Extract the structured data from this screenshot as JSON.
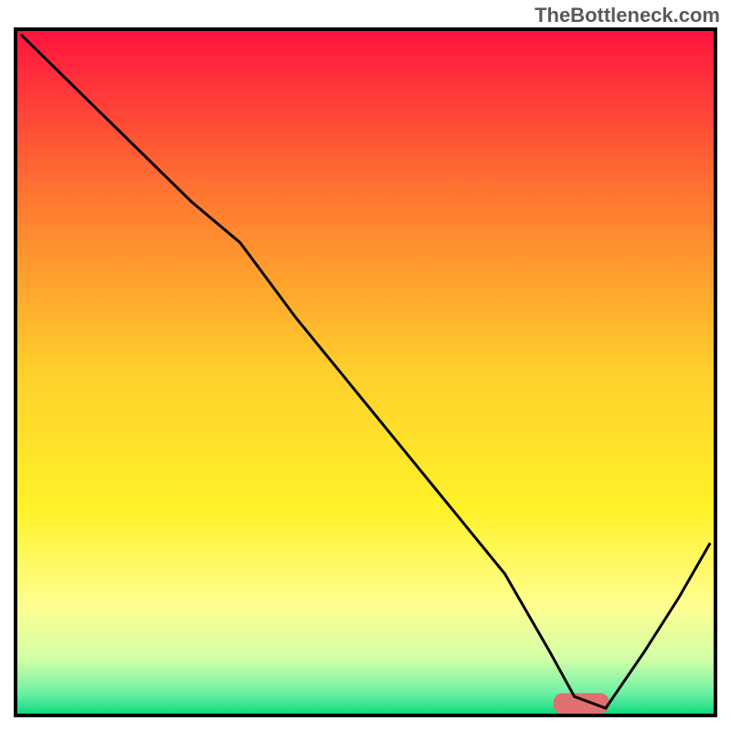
{
  "watermark": "TheBottleneck.com",
  "chart_data": {
    "type": "line",
    "title": "",
    "xlabel": "",
    "ylabel": "",
    "xlim": [
      0,
      100
    ],
    "ylim": [
      0,
      100
    ],
    "background_gradient": {
      "stops": [
        {
          "offset": 0.0,
          "color": "#ff143e"
        },
        {
          "offset": 0.25,
          "color": "#ff7a30"
        },
        {
          "offset": 0.5,
          "color": "#ffd02c"
        },
        {
          "offset": 0.7,
          "color": "#fff229"
        },
        {
          "offset": 0.84,
          "color": "#fffe8f"
        },
        {
          "offset": 0.92,
          "color": "#d2ffa7"
        },
        {
          "offset": 0.97,
          "color": "#6cf0a3"
        },
        {
          "offset": 1.0,
          "color": "#11d980"
        }
      ]
    },
    "optimum_marker": {
      "x_start": 77,
      "x_end": 85,
      "y": 1.5,
      "color": "#e07070",
      "width": 7.5,
      "height": 3
    },
    "series": [
      {
        "name": "bottleneck_curve",
        "color": "#000000",
        "x": [
          0.5,
          12,
          25,
          32,
          40,
          50,
          60,
          70,
          76.5,
          80,
          84.5,
          90,
          95,
          99.5
        ],
        "y": [
          99.5,
          88,
          75,
          69,
          58,
          45.5,
          33,
          20.5,
          9,
          2.5,
          0.8,
          9,
          17,
          25
        ]
      }
    ]
  }
}
